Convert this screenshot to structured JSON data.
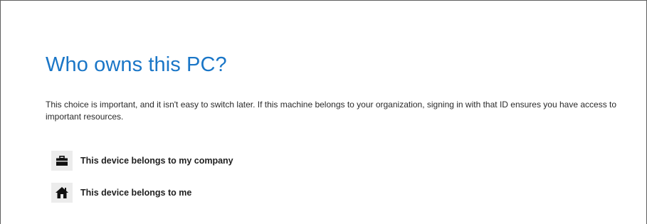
{
  "page": {
    "title": "Who owns this PC?",
    "description": "This choice is important, and it isn't easy to switch later. If this machine belongs to your organization, signing in with that ID ensures you have access to important resources."
  },
  "options": [
    {
      "label": "This device belongs to my company",
      "icon": "briefcase-icon"
    },
    {
      "label": "This device belongs to me",
      "icon": "home-icon"
    }
  ],
  "colors": {
    "title": "#1a76c7",
    "text": "#2a2a2a",
    "icon_bg": "#ececec"
  }
}
